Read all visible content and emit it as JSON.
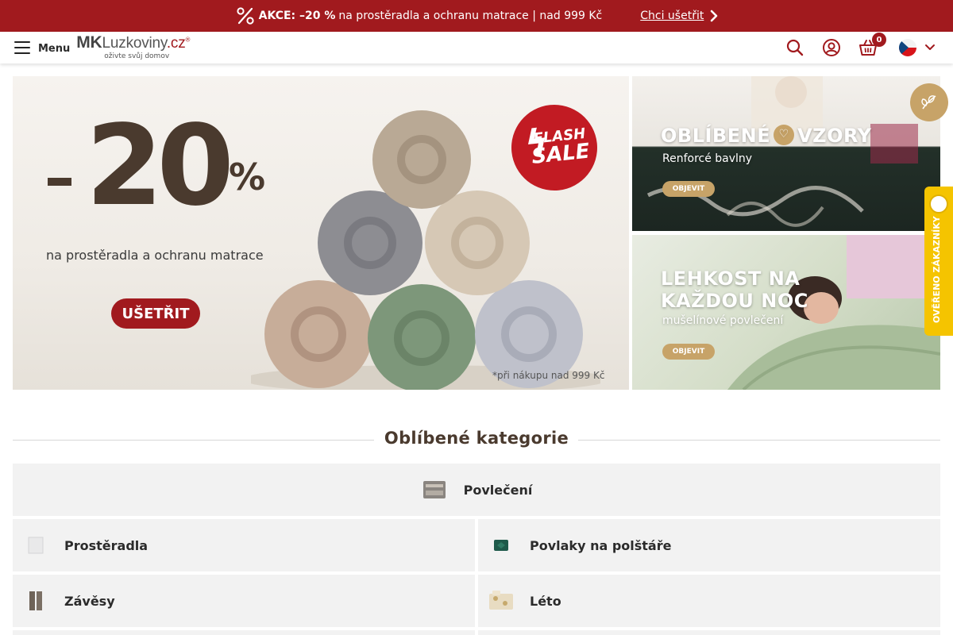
{
  "promo": {
    "akce": "AKCE: –20 %",
    "text": "na prostěradla a ochranu matrace | nad 999 Kč",
    "cta": "Chci ušetřit"
  },
  "header": {
    "menu_label": "Menu",
    "logo_main_mk": "MK",
    "logo_main_rest": "Luzkoviny",
    "logo_main_cz": ".cz",
    "logo_reg": "®",
    "logo_tagline": "oživte svůj domov",
    "cart_count": "0",
    "icons": [
      "search-icon",
      "user-icon",
      "basket-icon",
      "flag-cz-icon",
      "chevron-down-icon"
    ]
  },
  "banners": {
    "main": {
      "minus": "–",
      "big": "20",
      "percent": "%",
      "subtitle": "na prostěradla a ochranu matrace",
      "button": "UŠETŘIT",
      "flash1": "FLASH",
      "flash2": "SALE",
      "note": "*při nákupu nad 999 Kč"
    },
    "side1": {
      "title_left": "OBLÍBENÉ",
      "title_right": "VZORY",
      "subtitle": "Renforcé bavlny",
      "button": "OBJEVIT"
    },
    "side2": {
      "title_line1": "LEHKOST NA",
      "title_line2": "KAŽDOU NOC",
      "subtitle": "mušelínové povlečení",
      "button": "OBJEVIT"
    },
    "verified": "OVĚŘENO ZÁKAZNÍKY"
  },
  "categories": {
    "title": "Oblíbené kategorie",
    "items": [
      {
        "label": "Povlečení"
      },
      {
        "label": "Prostěradla"
      },
      {
        "label": "Povlaky na polštáře"
      },
      {
        "label": "Závěsy"
      },
      {
        "label": "Léto"
      }
    ]
  },
  "colors": {
    "brand_red": "#a11a1e",
    "brand_brown": "#4a3a2e",
    "gold": "#c7a368",
    "verified_yellow": "#f5c400",
    "category_bg": "#f2f2f2"
  }
}
